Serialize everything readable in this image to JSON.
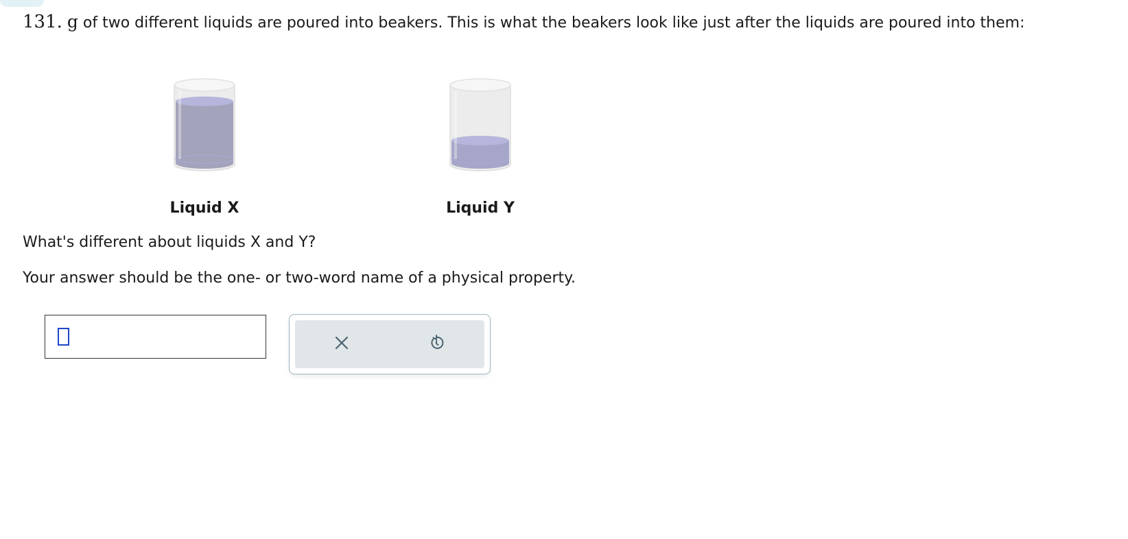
{
  "question": {
    "intro_number": "131.",
    "intro_unit": "g",
    "intro_text": "of two different liquids are poured into beakers. This is what the beakers look like just after the liquids are poured into them:",
    "prompt": "What's different about liquids X and Y?",
    "instruction": "Your answer should be the one- or two-word name of a physical property."
  },
  "beakers": [
    {
      "label": "Liquid X",
      "fill_fraction": 0.82,
      "liquid_color": "#a3a3bb"
    },
    {
      "label": "Liquid Y",
      "fill_fraction": 0.3,
      "liquid_color": "#a6a6c8"
    }
  ],
  "answer": {
    "value": ""
  },
  "toolbar": {
    "clear_icon": "close-icon",
    "undo_icon": "undo-icon"
  },
  "colors": {
    "cursor": "#1f44c8",
    "panel_bg": "#e1e6e9",
    "icon": "#4b6470",
    "corner_tab": "#e2f1f6"
  }
}
